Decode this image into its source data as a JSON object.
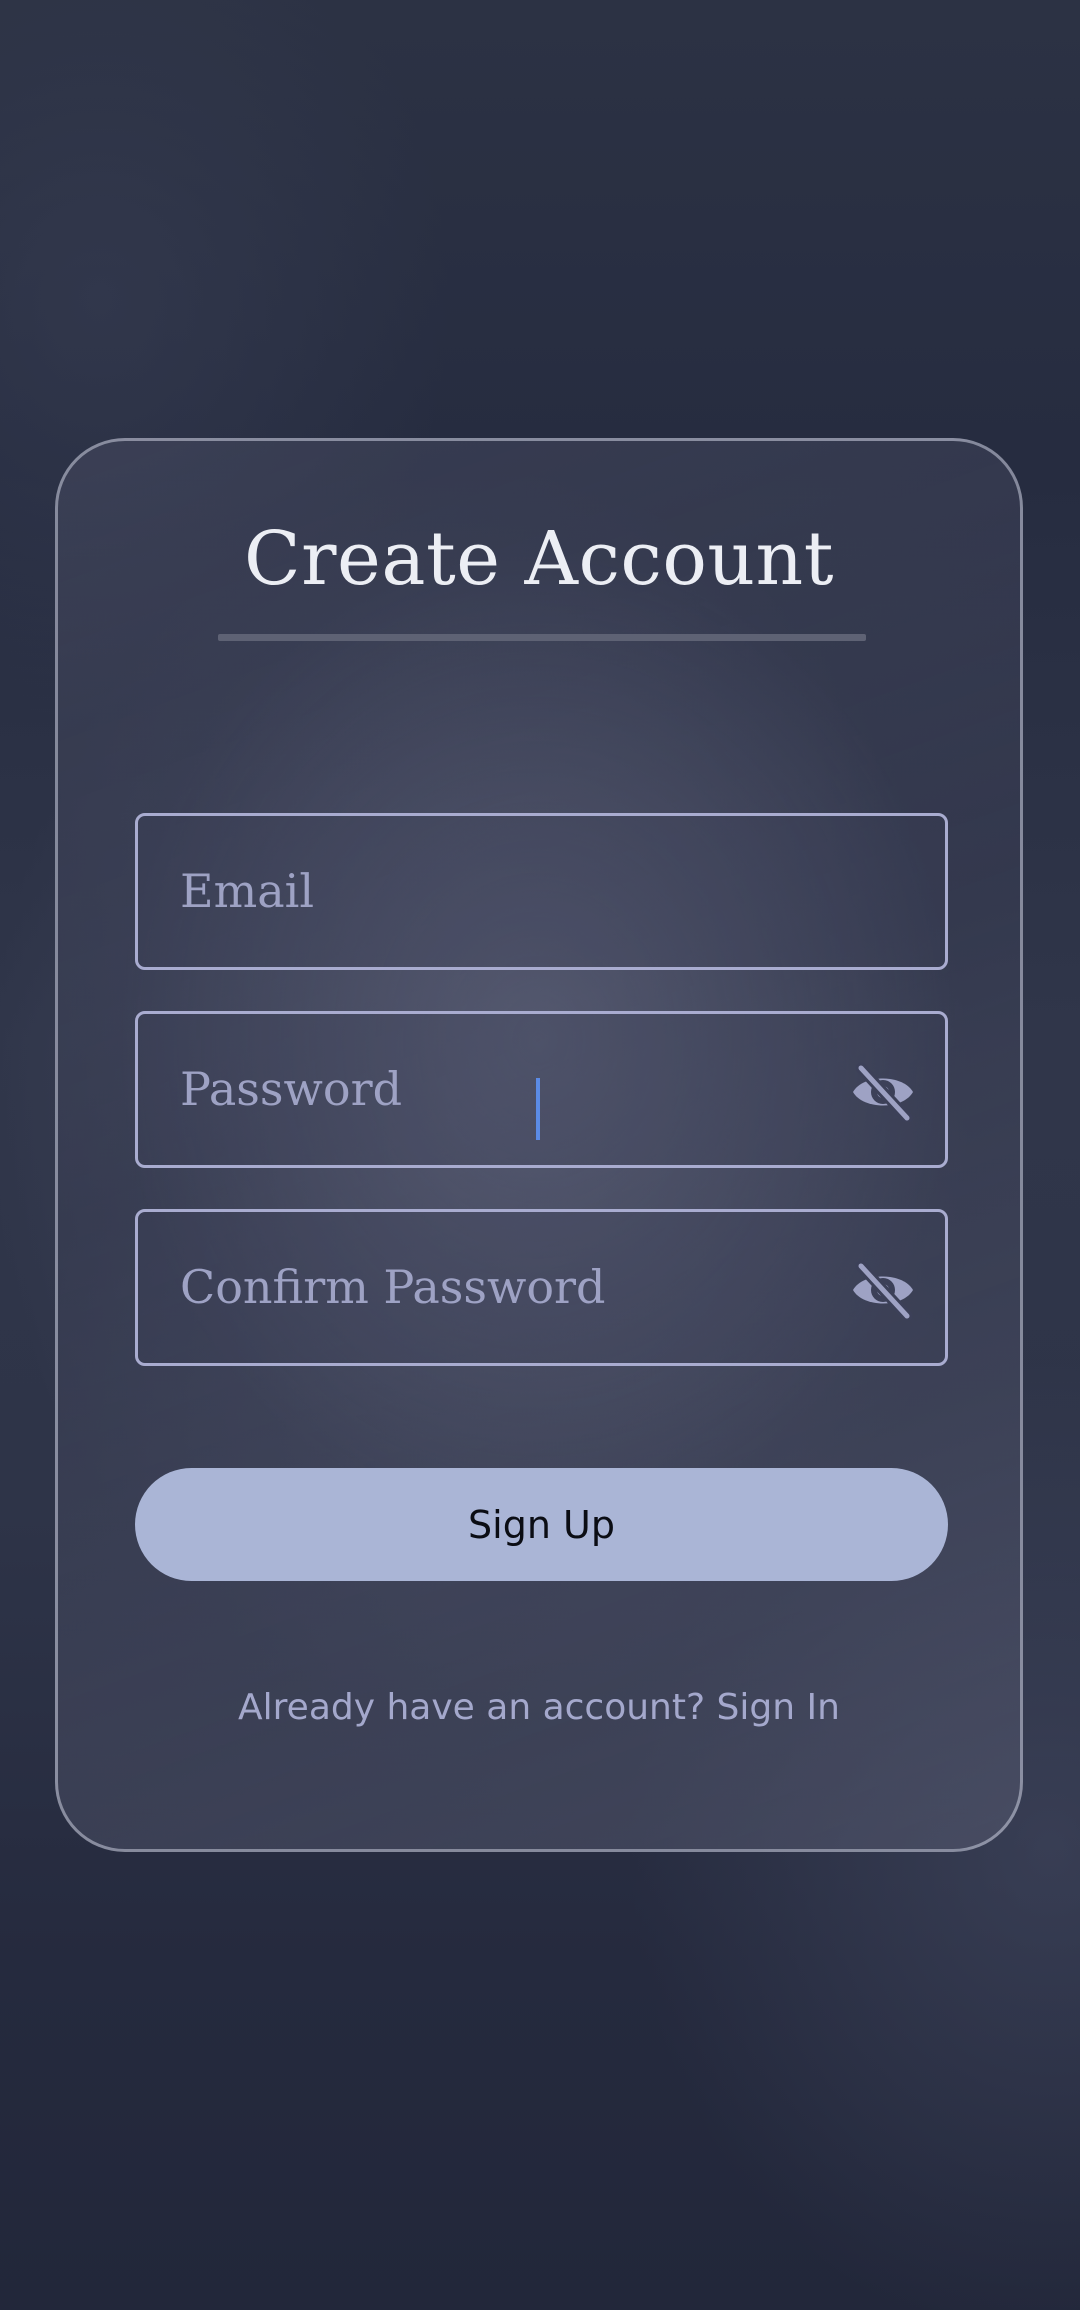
{
  "form": {
    "title": "Create Account",
    "email_placeholder": "Email",
    "password_placeholder": "Password",
    "confirm_placeholder": "Confirm Password",
    "submit_label": "Sign Up",
    "signin_link": "Already have an account? Sign In"
  },
  "icons": {
    "password_visibility": "eye-off-icon",
    "confirm_visibility": "eye-off-icon"
  },
  "colors": {
    "accent": "#aab5d6",
    "field_border": "#a9acd0",
    "placeholder": "#9ea2c4",
    "cursor": "#5b8be6",
    "title": "#eceef4"
  }
}
